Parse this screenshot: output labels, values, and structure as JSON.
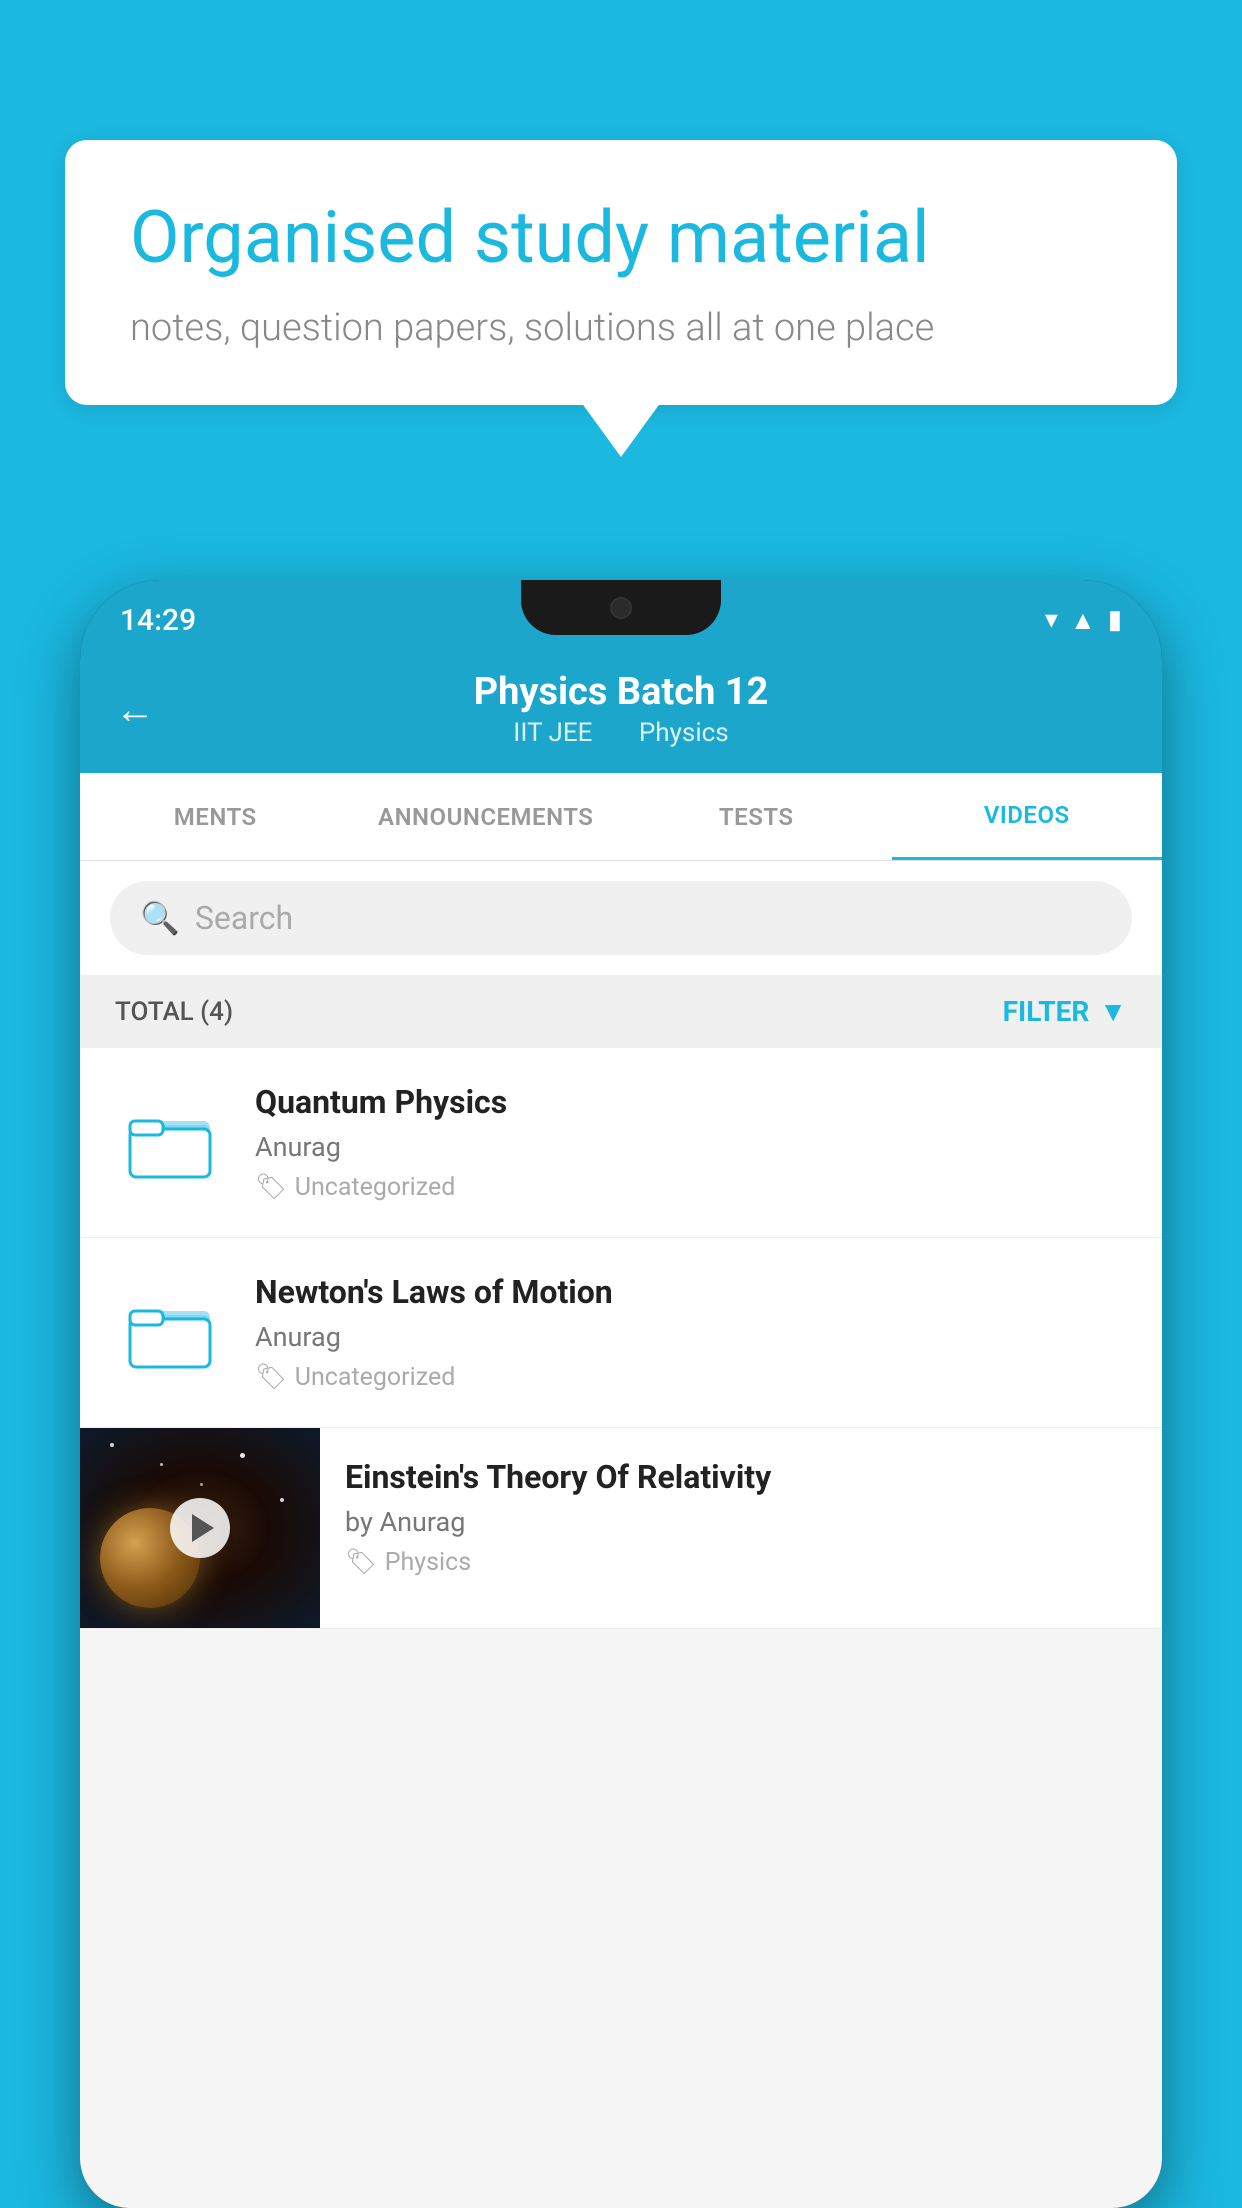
{
  "hero": {
    "title": "Organised study material",
    "subtitle": "notes, question papers, solutions all at one place"
  },
  "phone": {
    "status_bar": {
      "time": "14:29"
    },
    "header": {
      "back_label": "←",
      "title": "Physics Batch 12",
      "subtitle_tag1": "IIT JEE",
      "subtitle_tag2": "Physics"
    },
    "tabs": [
      {
        "label": "MENTS",
        "active": false
      },
      {
        "label": "ANNOUNCEMENTS",
        "active": false
      },
      {
        "label": "TESTS",
        "active": false
      },
      {
        "label": "VIDEOS",
        "active": true
      }
    ],
    "search": {
      "placeholder": "Search"
    },
    "filter": {
      "total_label": "TOTAL (4)",
      "filter_label": "FILTER"
    },
    "videos": [
      {
        "id": "quantum",
        "title": "Quantum Physics",
        "author": "Anurag",
        "tag": "Uncategorized",
        "has_thumbnail": false
      },
      {
        "id": "newton",
        "title": "Newton's Laws of Motion",
        "author": "Anurag",
        "tag": "Uncategorized",
        "has_thumbnail": false
      },
      {
        "id": "einstein",
        "title": "Einstein's Theory Of Relativity",
        "author": "by Anurag",
        "tag": "Physics",
        "has_thumbnail": true
      }
    ]
  }
}
